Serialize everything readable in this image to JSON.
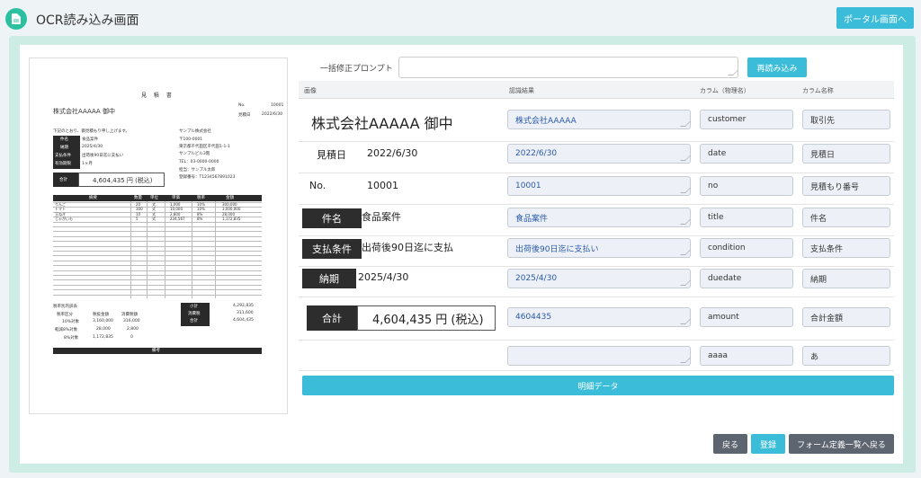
{
  "header": {
    "title": "OCR読み込み画面",
    "portal_label": "ポータル画面へ"
  },
  "prompt": {
    "label": "一括修正プロンプト",
    "value": "",
    "reread_label": "再読み込み"
  },
  "table": {
    "headers": [
      "画像",
      "認識結果",
      "カラム（物理名）",
      "カラム名称"
    ],
    "rows": [
      {
        "image_text": "株式会社AAAAA 御中",
        "result": "株式会社AAAAA",
        "physical": "customer",
        "name": "取引先"
      },
      {
        "image_label": "見積日",
        "image_text": "2022/6/30",
        "result": "2022/6/30",
        "physical": "date",
        "name": "見積日"
      },
      {
        "image_label": "No.",
        "image_text": "10001",
        "result": "10001",
        "physical": "no",
        "name": "見積もり番号"
      },
      {
        "image_label": "件名",
        "image_text": "食品案件",
        "result": "食品案件",
        "physical": "title",
        "name": "件名"
      },
      {
        "image_label": "支払条件",
        "image_text": "出荷後90日迄に支払",
        "result": "出荷後90日迄に支払い",
        "physical": "condition",
        "name": "支払条件"
      },
      {
        "image_label": "納期",
        "image_text": "2025/4/30",
        "result": "2025/4/30",
        "physical": "duedate",
        "name": "納期"
      },
      {
        "image_label": "合計",
        "image_text": "4,604,435 円 (税込)",
        "result": "4604435",
        "physical": "amount",
        "name": "合計金額"
      },
      {
        "result": "",
        "physical": "aaaa",
        "name": "あ"
      }
    ]
  },
  "detail_label": "明細データ",
  "footer": {
    "back_label": "戻る",
    "register_label": "登録",
    "form_list_label": "フォーム定義一覧へ戻る"
  },
  "doc": {
    "title": "見 積 書",
    "customer": "株式会社AAAAA 御中",
    "no_label": "No.",
    "no_value": "10001",
    "date_label": "見積日",
    "date_value": "2022/6/30",
    "intro": "下記のとおり、御見積もり申し上げます。",
    "info": [
      {
        "label": "件名",
        "value": "食品案件"
      },
      {
        "label": "納期",
        "value": "2025/4/30"
      },
      {
        "label": "支払条件",
        "value": "出荷後90日迄に支払い"
      },
      {
        "label": "有効期限",
        "value": "1ヶ月"
      }
    ],
    "company": [
      "サンプル株式会社",
      "〒100-0001",
      "東京都千代田区千代田1-1-1",
      "サンプルビル3階",
      "TEL：03-0000-0000",
      "担当：サンプル太郎",
      "登録番号：T1234567891023"
    ],
    "total_label": "合計",
    "total_value": "4,604,435 円 (税込)",
    "item_headers": [
      "摘要",
      "数量",
      "単位",
      "単価",
      "税率",
      "金額"
    ],
    "items": [
      [
        "りんご",
        "20",
        "式",
        "1,000",
        "10%",
        "300,000"
      ],
      [
        "トマト",
        "300",
        "式",
        "10,000",
        "10%",
        "3,000,000"
      ],
      [
        "玉ねぎ",
        "10",
        "式",
        "2,800",
        "8%",
        "28,000"
      ],
      [
        "じゃがいも",
        "5",
        "式",
        "234,567",
        "8%",
        "1,172,835"
      ]
    ],
    "tax_title": "税率別内訳表",
    "tax_headers": [
      "税率区分",
      "税抜金額",
      "消費税額"
    ],
    "tax_rows": [
      [
        "10%対象",
        "3,160,000",
        "316,000"
      ],
      [
        "軽減8%対象",
        "28,000",
        "2,800"
      ],
      [
        "8%対象",
        "1,172,835",
        "0"
      ]
    ],
    "sum_rows": [
      [
        "小計",
        "4,292,835"
      ],
      [
        "消費税",
        "311,600"
      ],
      [
        "合計",
        "4,604,435"
      ]
    ],
    "remarks": "備考"
  }
}
